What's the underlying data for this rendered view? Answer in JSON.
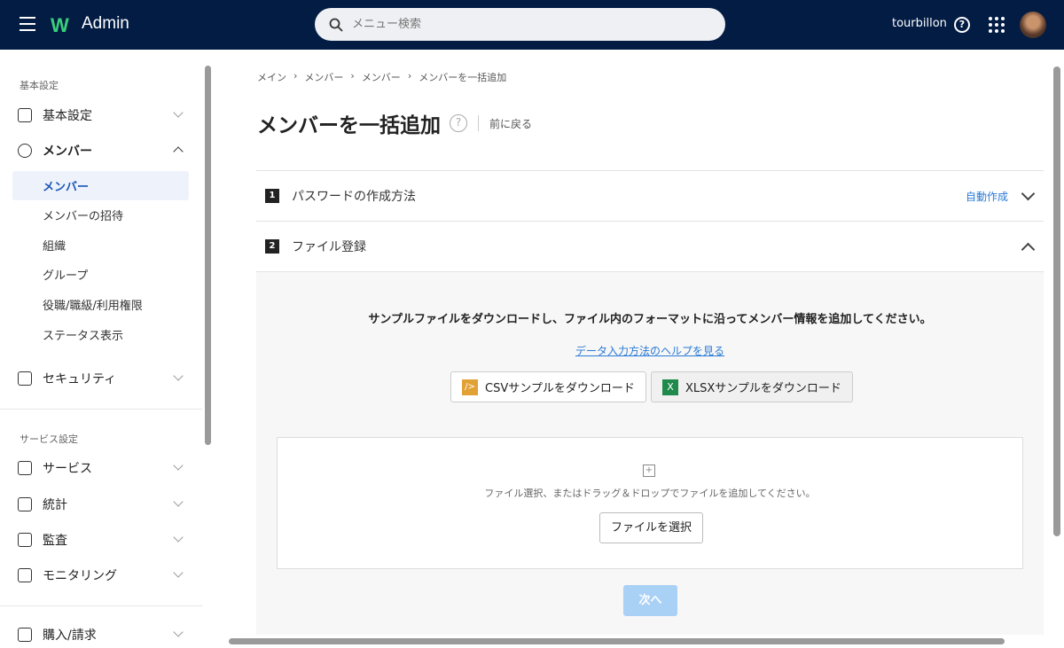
{
  "header": {
    "app_name": "Admin",
    "search_placeholder": "メニュー検索",
    "username": "tourbillon",
    "help_label": "?"
  },
  "sidebar": {
    "section1": "基本設定",
    "items": [
      {
        "label": "基本設定",
        "icon": "building-icon"
      },
      {
        "label": "メンバー",
        "icon": "users-icon"
      }
    ],
    "member_sub": [
      "メンバー",
      "メンバーの招待",
      "組織",
      "グループ",
      "役職/職級/利用権限",
      "ステータス表示"
    ],
    "security": "セキュリティ",
    "section2": "サービス設定",
    "services": [
      {
        "label": "サービス",
        "icon": "apps-icon"
      },
      {
        "label": "統計",
        "icon": "chart-icon"
      },
      {
        "label": "監査",
        "icon": "audit-icon"
      },
      {
        "label": "モニタリング",
        "icon": "monitor-icon"
      }
    ],
    "billing": "購入/請求"
  },
  "breadcrumb": [
    "メイン",
    "メンバー",
    "メンバー",
    "メンバーを一括追加"
  ],
  "page": {
    "title": "メンバーを一括追加",
    "help": "?",
    "back": "前に戻る"
  },
  "steps": [
    {
      "num": "1",
      "label": "パスワードの作成方法",
      "value": "自動作成"
    },
    {
      "num": "2",
      "label": "ファイル登録"
    }
  ],
  "file": {
    "instruction": "サンプルファイルをダウンロードし、ファイル内のフォーマットに沿ってメンバー情報を追加してください。",
    "help_link": "データ入力方法のヘルプを見る",
    "csv_button": "CSVサンプルをダウンロード",
    "csv_icon": "/>",
    "xlsx_button": "XLSXサンプルをダウンロード",
    "xlsx_icon": "X",
    "drop_text": "ファイル選択、またはドラッグ＆ドロップでファイルを追加してください。",
    "drop_icon": "+",
    "select_button": "ファイルを選択",
    "next_button": "次へ"
  },
  "colors": {
    "header_bg": "#021c44",
    "link": "#2a7ad5",
    "next_disabled": "#a9d0f5",
    "active_bg": "#eef3fb"
  }
}
